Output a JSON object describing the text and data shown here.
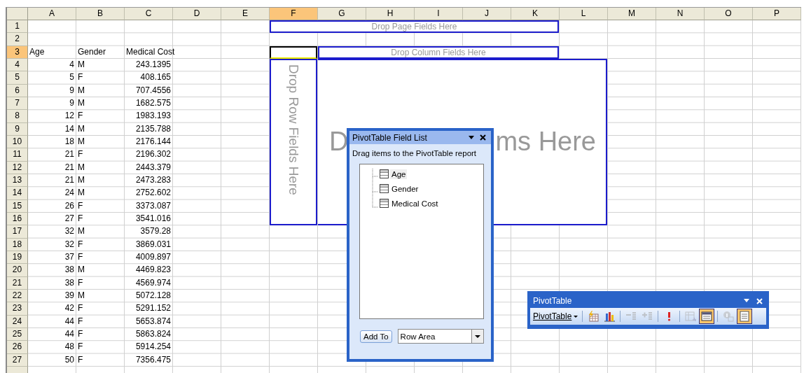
{
  "sheet": {
    "columns": [
      {
        "label": "A",
        "selected": false
      },
      {
        "label": "B",
        "selected": false
      },
      {
        "label": "C",
        "selected": false
      },
      {
        "label": "D",
        "selected": false
      },
      {
        "label": "E",
        "selected": false
      },
      {
        "label": "F",
        "selected": true
      },
      {
        "label": "G",
        "selected": false
      },
      {
        "label": "H",
        "selected": false
      },
      {
        "label": "I",
        "selected": false
      },
      {
        "label": "J",
        "selected": false
      },
      {
        "label": "K",
        "selected": false
      },
      {
        "label": "L",
        "selected": false
      },
      {
        "label": "M",
        "selected": false
      },
      {
        "label": "N",
        "selected": false
      },
      {
        "label": "O",
        "selected": false
      },
      {
        "label": "P",
        "selected": false
      }
    ],
    "rows": [
      {
        "number": "1",
        "selected": false
      },
      {
        "number": "2",
        "selected": false
      },
      {
        "number": "3",
        "selected": true,
        "kind": "header",
        "cells": [
          "Age",
          "Gender",
          "Medical Cost"
        ]
      },
      {
        "number": "4",
        "selected": false,
        "kind": "data",
        "cells": [
          "4",
          "M",
          "243.1395"
        ]
      },
      {
        "number": "5",
        "selected": false,
        "kind": "data",
        "cells": [
          "5",
          "F",
          "408.165"
        ]
      },
      {
        "number": "6",
        "selected": false,
        "kind": "data",
        "cells": [
          "9",
          "M",
          "707.4556"
        ]
      },
      {
        "number": "7",
        "selected": false,
        "kind": "data",
        "cells": [
          "9",
          "M",
          "1682.575"
        ]
      },
      {
        "number": "8",
        "selected": false,
        "kind": "data",
        "cells": [
          "12",
          "F",
          "1983.193"
        ]
      },
      {
        "number": "9",
        "selected": false,
        "kind": "data",
        "cells": [
          "14",
          "M",
          "2135.788"
        ]
      },
      {
        "number": "10",
        "selected": false,
        "kind": "data",
        "cells": [
          "18",
          "M",
          "2176.144"
        ]
      },
      {
        "number": "11",
        "selected": false,
        "kind": "data",
        "cells": [
          "21",
          "F",
          "2196.302"
        ]
      },
      {
        "number": "12",
        "selected": false,
        "kind": "data",
        "cells": [
          "21",
          "M",
          "2443.379"
        ]
      },
      {
        "number": "13",
        "selected": false,
        "kind": "data",
        "cells": [
          "21",
          "M",
          "2473.283"
        ]
      },
      {
        "number": "14",
        "selected": false,
        "kind": "data",
        "cells": [
          "24",
          "M",
          "2752.602"
        ]
      },
      {
        "number": "15",
        "selected": false,
        "kind": "data",
        "cells": [
          "26",
          "F",
          "3373.087"
        ]
      },
      {
        "number": "16",
        "selected": false,
        "kind": "data",
        "cells": [
          "27",
          "F",
          "3541.016"
        ]
      },
      {
        "number": "17",
        "selected": false,
        "kind": "data",
        "cells": [
          "32",
          "M",
          "3579.28"
        ]
      },
      {
        "number": "18",
        "selected": false,
        "kind": "data",
        "cells": [
          "32",
          "F",
          "3869.031"
        ]
      },
      {
        "number": "19",
        "selected": false,
        "kind": "data",
        "cells": [
          "37",
          "F",
          "4009.897"
        ]
      },
      {
        "number": "20",
        "selected": false,
        "kind": "data",
        "cells": [
          "38",
          "M",
          "4469.823"
        ]
      },
      {
        "number": "21",
        "selected": false,
        "kind": "data",
        "cells": [
          "38",
          "F",
          "4569.974"
        ]
      },
      {
        "number": "22",
        "selected": false,
        "kind": "data",
        "cells": [
          "39",
          "M",
          "5072.128"
        ]
      },
      {
        "number": "23",
        "selected": false,
        "kind": "data",
        "cells": [
          "42",
          "F",
          "5291.152"
        ]
      },
      {
        "number": "24",
        "selected": false,
        "kind": "data",
        "cells": [
          "44",
          "F",
          "5653.874"
        ]
      },
      {
        "number": "25",
        "selected": false,
        "kind": "data",
        "cells": [
          "44",
          "F",
          "5863.824"
        ]
      },
      {
        "number": "26",
        "selected": false,
        "kind": "data",
        "cells": [
          "48",
          "F",
          "5914.254"
        ]
      },
      {
        "number": "27",
        "selected": false,
        "kind": "data",
        "cells": [
          "50",
          "F",
          "7356.475"
        ]
      }
    ]
  },
  "pivot_areas": {
    "page_fields": "Drop Page Fields Here",
    "column_fields": "Drop Column Fields Here",
    "row_fields": "Drop Row Fields Here",
    "data_items_visible_parts": [
      "D",
      "ms Here"
    ]
  },
  "field_list": {
    "title": "PivotTable Field List",
    "instruction": "Drag items to the PivotTable report",
    "fields": [
      {
        "label": "Age",
        "selected": true
      },
      {
        "label": "Gender",
        "selected": false
      },
      {
        "label": "Medical Cost",
        "selected": false
      }
    ],
    "add_button": "Add To",
    "area_dropdown": "Row Area"
  },
  "toolbar": {
    "title": "PivotTable",
    "buttons": [
      {
        "kind": "menu",
        "label": "PivotTable"
      },
      {
        "kind": "format",
        "pressed": false,
        "disabled": false
      },
      {
        "kind": "chart",
        "pressed": false,
        "disabled": false
      },
      {
        "kind": "hide-detail",
        "pressed": false,
        "disabled": true
      },
      {
        "kind": "show-detail",
        "pressed": false,
        "disabled": true
      },
      {
        "kind": "refresh",
        "pressed": false,
        "disabled": false
      },
      {
        "kind": "settings",
        "pressed": false,
        "disabled": true
      },
      {
        "kind": "field-list",
        "pressed": true,
        "disabled": false
      },
      {
        "kind": "info",
        "pressed": false,
        "disabled": true
      },
      {
        "kind": "display-items",
        "pressed": true,
        "disabled": false
      }
    ]
  }
}
